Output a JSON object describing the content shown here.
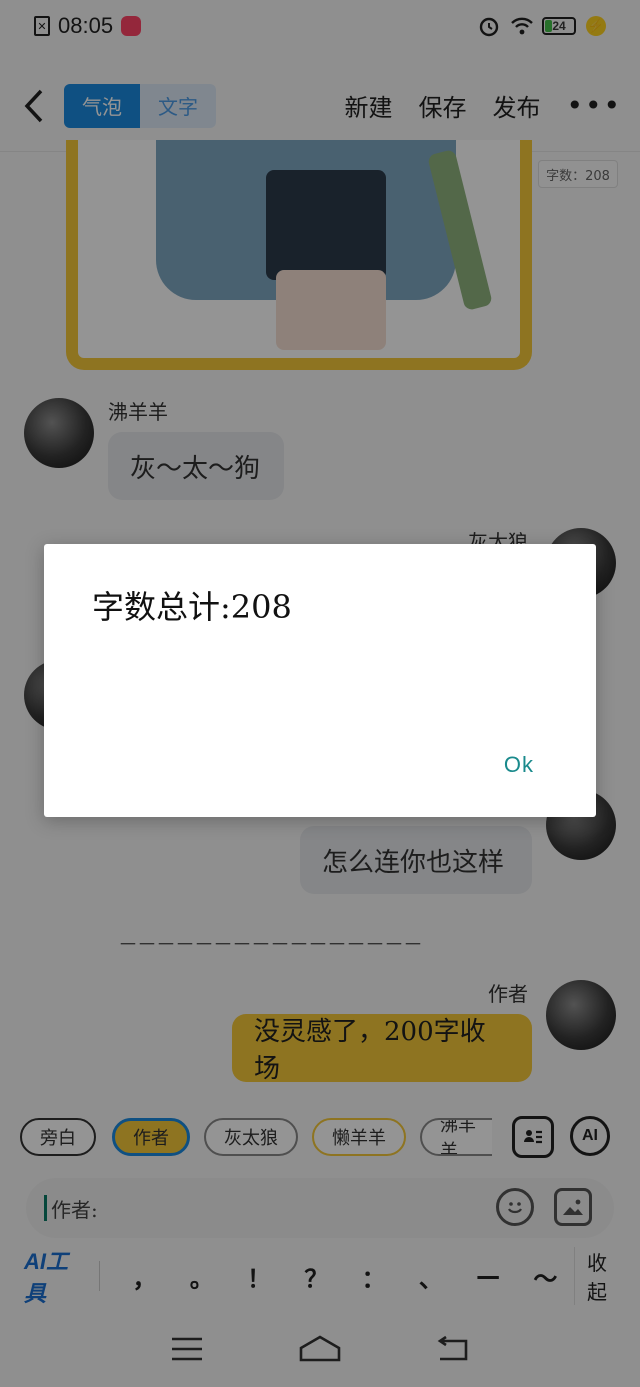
{
  "status_bar": {
    "time": "08:05",
    "battery": "24"
  },
  "header": {
    "tabs": [
      {
        "label": "气泡",
        "active": true
      },
      {
        "label": "文字",
        "active": false
      }
    ],
    "actions": {
      "new": "新建",
      "save": "保存",
      "publish": "发布",
      "more": "•••"
    }
  },
  "word_count_badge": "字数：208",
  "chat": {
    "messages": [
      {
        "name": "沸羊羊",
        "text": "灰～太～狗"
      },
      {
        "name": "灰太狼",
        "text": ""
      },
      {
        "name": "",
        "text": "怎么连你也这样"
      },
      {
        "name": "作者",
        "text": "没灵感了，200字收场"
      }
    ],
    "divider": "－－－－－－－－－－－－－－－－"
  },
  "roles": [
    "旁白",
    "作者",
    "灰太狼",
    "懒羊羊",
    "沸羊羊"
  ],
  "role_tools": {
    "ai_label": "AI"
  },
  "input": {
    "value": "作者:"
  },
  "punctuation_bar": {
    "ai_tools": "AI工具",
    "keys": [
      "，",
      "。",
      "！",
      "？",
      "：",
      "、",
      "—",
      "～"
    ],
    "collapse": "收起"
  },
  "dialog": {
    "message": "字数总计:208",
    "ok": "Ok"
  },
  "colors": {
    "accent_blue": "#1a8be0",
    "bubble_yellow": "#f4c83a",
    "ok_teal": "#1a8a8c"
  }
}
